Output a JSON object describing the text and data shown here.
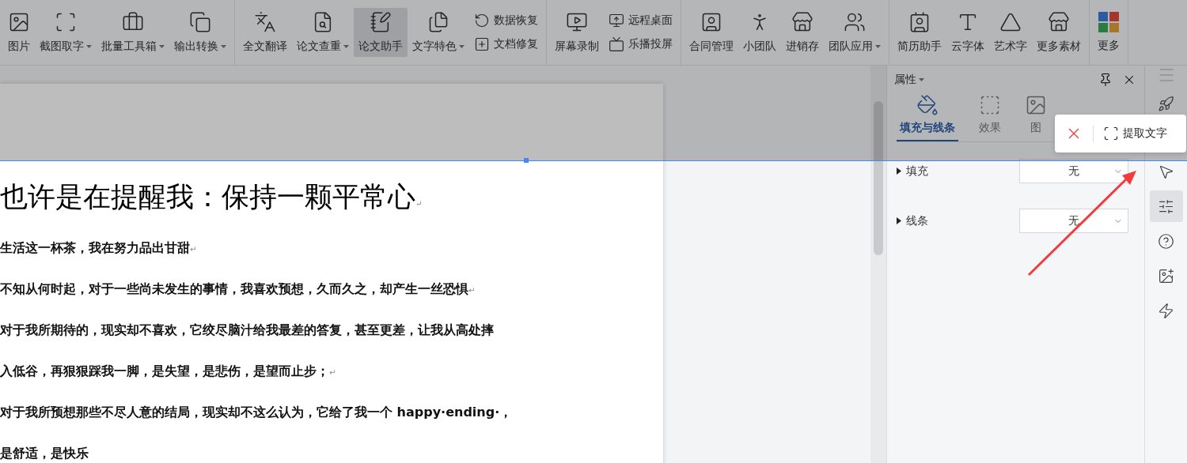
{
  "toolbar": {
    "groups": [
      [
        {
          "kind": "large",
          "label": "图片",
          "dropdown": false,
          "selected": false
        },
        {
          "kind": "large",
          "label": "截图取字",
          "dropdown": true,
          "selected": false
        },
        {
          "kind": "large",
          "label": "批量工具箱",
          "dropdown": true,
          "selected": false
        },
        {
          "kind": "large",
          "label": "输出转换",
          "dropdown": true,
          "selected": false
        }
      ],
      [
        {
          "kind": "large",
          "label": "全文翻译",
          "dropdown": false,
          "selected": false
        },
        {
          "kind": "large",
          "label": "论文查重",
          "dropdown": true,
          "selected": false
        },
        {
          "kind": "large",
          "label": "论文助手",
          "dropdown": false,
          "selected": true
        },
        {
          "kind": "large",
          "label": "文字特色",
          "dropdown": true,
          "selected": false
        },
        {
          "kind": "stack",
          "entries": [
            {
              "label": "数据恢复"
            },
            {
              "label": "文档修复"
            }
          ]
        }
      ],
      [
        {
          "kind": "large",
          "label": "屏幕录制",
          "dropdown": false,
          "selected": false
        },
        {
          "kind": "stack",
          "entries": [
            {
              "label": "远程桌面"
            },
            {
              "label": "乐播投屏"
            }
          ]
        }
      ],
      [
        {
          "kind": "large",
          "label": "合同管理",
          "dropdown": false,
          "selected": false
        },
        {
          "kind": "large",
          "label": "小团队",
          "dropdown": false,
          "selected": false
        },
        {
          "kind": "large",
          "label": "进销存",
          "dropdown": false,
          "selected": false
        },
        {
          "kind": "large",
          "label": "团队应用",
          "dropdown": true,
          "selected": false
        }
      ],
      [
        {
          "kind": "large",
          "label": "简历助手",
          "dropdown": false,
          "selected": false
        },
        {
          "kind": "large",
          "label": "云字体",
          "dropdown": false,
          "selected": false
        },
        {
          "kind": "large",
          "label": "艺术字",
          "dropdown": false,
          "selected": false
        },
        {
          "kind": "large",
          "label": "更多素材",
          "dropdown": false,
          "selected": false
        }
      ],
      [
        {
          "kind": "large",
          "label": "更多",
          "dropdown": false,
          "selected": false
        }
      ]
    ]
  },
  "document": {
    "title": {
      "text": "也许是在提醒我：保持一颗平常心",
      "mark": "↵"
    },
    "paragraphs": [
      {
        "text": "生活这一杯茶，我在努力品出甘甜",
        "mark": "↵"
      },
      {
        "text": "不知从何时起，对于一些尚未发生的事情，我喜欢预想，久而久之，却产生一丝恐惧",
        "mark": "↵"
      },
      {
        "text": "对于我所期待的，现实却不喜欢，它绞尽脑汁给我最差的答复，甚至更差，让我从高处摔"
      },
      {
        "text": "入低谷，再狠狠踩我一脚，是失望，是悲伤，是望而止步；",
        "mark": "↵"
      },
      {
        "text": "对于我所预想那些不尽人意的结局，现实却不这么认为，它给了我一个 happy·ending·，"
      },
      {
        "text": "是舒适，是快乐"
      }
    ]
  },
  "panel": {
    "title": "属性",
    "tabs": [
      {
        "label": "填充与线条",
        "selected": true
      },
      {
        "label": "效果",
        "selected": false
      },
      {
        "label": "图",
        "selected": false
      }
    ],
    "properties": [
      {
        "label": "填充",
        "value": "无"
      },
      {
        "label": "线条",
        "value": "无"
      }
    ]
  },
  "popup": {
    "action": "提取文字"
  },
  "sidebar": {
    "items": [
      {
        "selected": false
      },
      {
        "selected": false
      },
      {
        "selected": true
      },
      {
        "selected": false
      },
      {
        "selected": false
      },
      {
        "selected": false
      }
    ]
  }
}
